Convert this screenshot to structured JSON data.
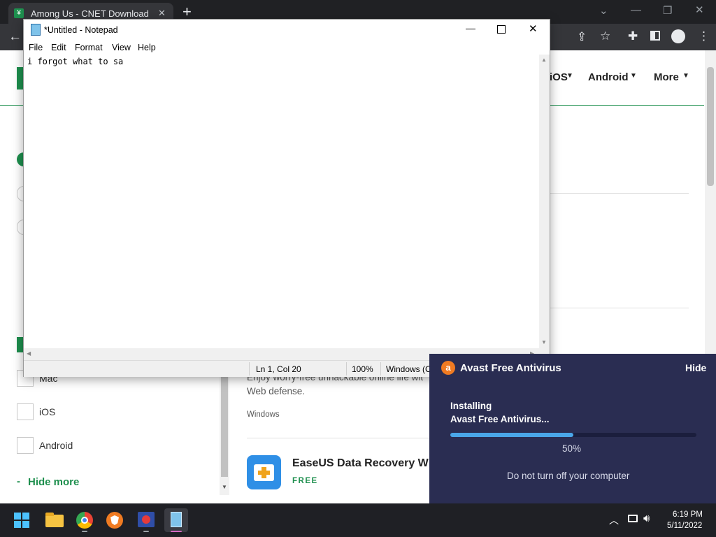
{
  "browser": {
    "tab_title": "Among Us - CNET Download",
    "new_tab": "+",
    "window_controls": [
      "⌄",
      "—",
      "❐",
      "✕"
    ]
  },
  "site": {
    "nav": [
      "iOS",
      "Android",
      "More"
    ],
    "filters": [
      "Mac",
      "iOS",
      "Android"
    ],
    "hide_more": "Hide more",
    "product_snippet": {
      "desc_line1": "Enjoy worry-free unhackable online life wit",
      "desc_line2": "Web defense.",
      "platform": "Windows"
    },
    "easeus": {
      "title": "EaseUS Data Recovery W",
      "badge": "FREE"
    }
  },
  "notepad": {
    "title": "*Untitled - Notepad",
    "menu": [
      "File",
      "Edit",
      "Format",
      "View",
      "Help"
    ],
    "content": "i forgot what to sa",
    "status": {
      "position": "Ln 1, Col 20",
      "zoom": "100%",
      "encoding": "Windows (C"
    }
  },
  "avast": {
    "title": "Avast Free Antivirus",
    "hide": "Hide",
    "status_line1": "Installing",
    "status_line2": "Avast Free Antivirus...",
    "progress": 0.5,
    "progress_label": "50%",
    "note": "Do not turn off your computer",
    "accent": "#4aa6e8"
  },
  "taskbar": {
    "time": "6:19 PM",
    "date": "5/11/2022"
  }
}
